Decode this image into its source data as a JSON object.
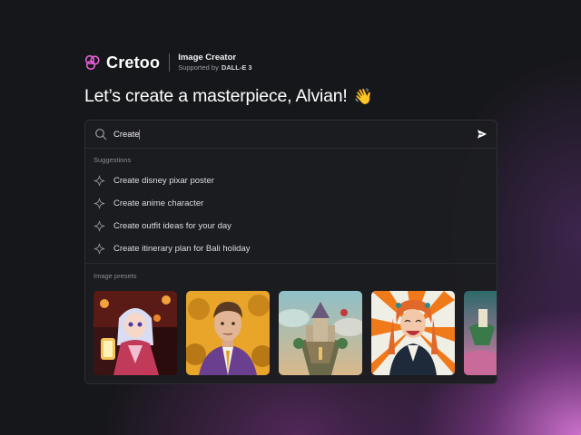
{
  "brand": {
    "name": "Cretoo",
    "product": "Image Creator",
    "supported_by_label": "Supported by",
    "supported_by_value": "DALL-E 3"
  },
  "headline": {
    "text": "Let’s create a masterpiece, Alvian!",
    "emoji": "👋"
  },
  "search": {
    "value": "Create",
    "placeholder": ""
  },
  "suggestions": {
    "label": "Suggestions",
    "items": [
      {
        "label": "Create disney pixar poster"
      },
      {
        "label": "Create anime character"
      },
      {
        "label": "Create outfit ideas for your day"
      },
      {
        "label": "Create itinerary plan for Bali holiday"
      }
    ]
  },
  "presets": {
    "label": "Image presets",
    "items": [
      {
        "name": "anime-girl-kimono-lantern"
      },
      {
        "name": "man-in-purple-suit"
      },
      {
        "name": "floating-castle-island"
      },
      {
        "name": "laughing-woman-orange-rays"
      },
      {
        "name": "floating-islands-partial"
      }
    ]
  },
  "colors": {
    "background": "#16171a",
    "accent_glow": "#d676d6",
    "caret": "#e8589a",
    "logo": "#e85fd8"
  }
}
